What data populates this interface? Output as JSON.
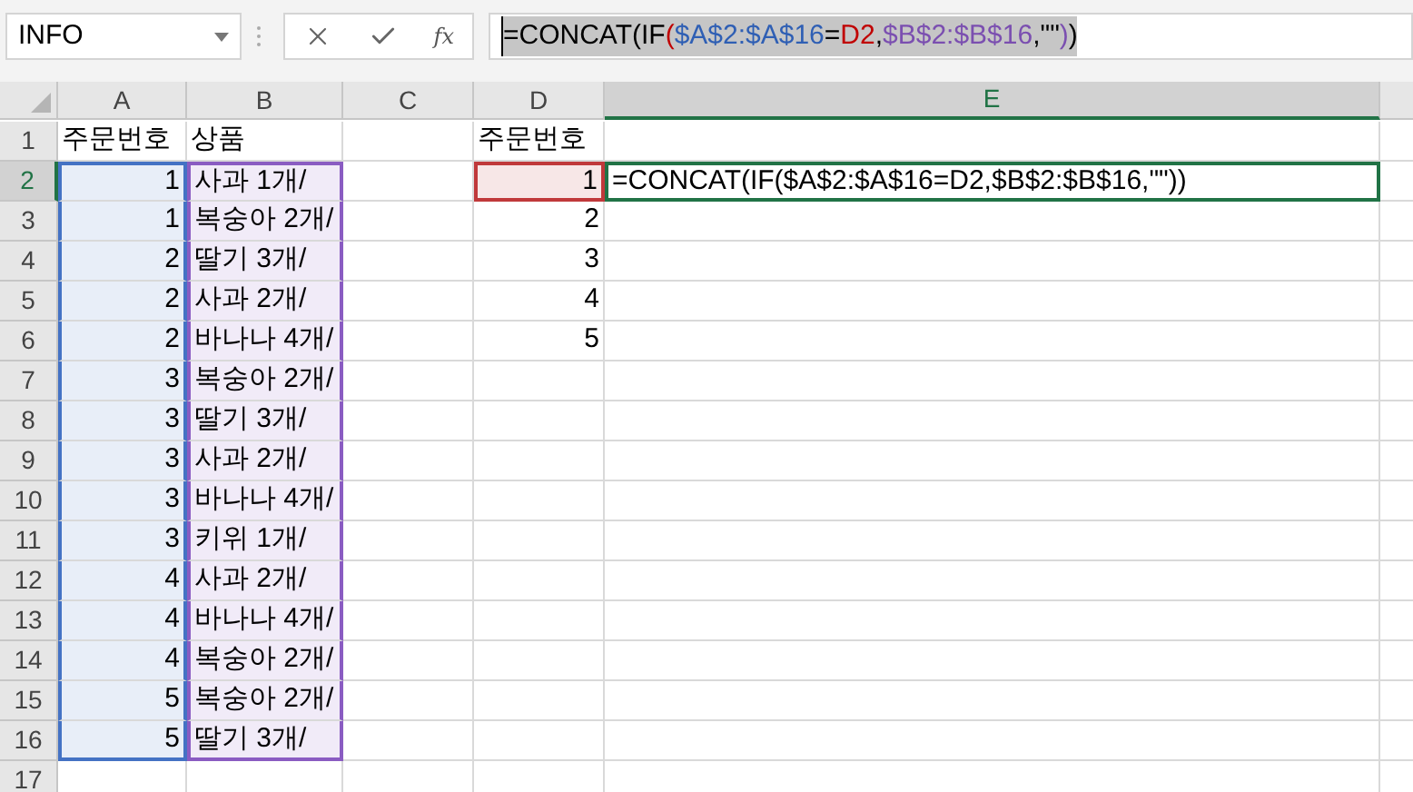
{
  "name_box": {
    "value": "INFO"
  },
  "formula_bar": {
    "function_button": "fx",
    "segments": [
      {
        "text": "=CONCAT(IF",
        "color": "#000000"
      },
      {
        "text": "(",
        "color": "#c00000"
      },
      {
        "text": "$A$2:$A$16",
        "color": "#2f5fb4"
      },
      {
        "text": "=",
        "color": "#000000"
      },
      {
        "text": "D2",
        "color": "#c00000"
      },
      {
        "text": ",",
        "color": "#000000"
      },
      {
        "text": "$B$2:$B$16",
        "color": "#7b4fb0"
      },
      {
        "text": ",\"\"",
        "color": "#000000"
      },
      {
        "text": ")",
        "color": "#7b4fb0"
      },
      {
        "text": ")",
        "color": "#000000"
      }
    ]
  },
  "columns": [
    {
      "label": "A",
      "selected": false
    },
    {
      "label": "B",
      "selected": false
    },
    {
      "label": "C",
      "selected": false
    },
    {
      "label": "D",
      "selected": false
    },
    {
      "label": "E",
      "selected": true
    }
  ],
  "rows": [
    {
      "number": "1",
      "selected": false,
      "cells": {
        "A": {
          "text": "주문번호",
          "kind": "text"
        },
        "B": {
          "text": "상품",
          "kind": "text"
        },
        "D": {
          "text": "주문번호",
          "kind": "text"
        }
      }
    },
    {
      "number": "2",
      "selected": true,
      "cells": {
        "A": {
          "text": "1",
          "kind": "number",
          "color": "#4472c4"
        },
        "B": {
          "text": "사과 1개/",
          "kind": "text",
          "color": "#8a5cc2"
        },
        "D": {
          "text": "1",
          "kind": "number",
          "color": "#c0393b"
        },
        "E": {
          "text": "=CONCAT(IF($A$2:$A$16=D2,$B$2:$B$16,\"\"))",
          "kind": "text",
          "active": true
        }
      }
    },
    {
      "number": "3",
      "selected": false,
      "cells": {
        "A": {
          "text": "1",
          "kind": "number",
          "color": "#4472c4"
        },
        "B": {
          "text": "복숭아 2개/",
          "kind": "text",
          "color": "#8a5cc2"
        },
        "D": {
          "text": "2",
          "kind": "number"
        }
      }
    },
    {
      "number": "4",
      "selected": false,
      "cells": {
        "A": {
          "text": "2",
          "kind": "number",
          "color": "#4472c4"
        },
        "B": {
          "text": "딸기 3개/",
          "kind": "text",
          "color": "#8a5cc2"
        },
        "D": {
          "text": "3",
          "kind": "number"
        }
      }
    },
    {
      "number": "5",
      "selected": false,
      "cells": {
        "A": {
          "text": "2",
          "kind": "number",
          "color": "#4472c4"
        },
        "B": {
          "text": "사과 2개/",
          "kind": "text",
          "color": "#8a5cc2"
        },
        "D": {
          "text": "4",
          "kind": "number"
        }
      }
    },
    {
      "number": "6",
      "selected": false,
      "cells": {
        "A": {
          "text": "2",
          "kind": "number",
          "color": "#4472c4"
        },
        "B": {
          "text": "바나나 4개/",
          "kind": "text",
          "color": "#8a5cc2"
        },
        "D": {
          "text": "5",
          "kind": "number"
        }
      }
    },
    {
      "number": "7",
      "selected": false,
      "cells": {
        "A": {
          "text": "3",
          "kind": "number",
          "color": "#4472c4"
        },
        "B": {
          "text": "복숭아 2개/",
          "kind": "text",
          "color": "#8a5cc2"
        }
      }
    },
    {
      "number": "8",
      "selected": false,
      "cells": {
        "A": {
          "text": "3",
          "kind": "number",
          "color": "#4472c4"
        },
        "B": {
          "text": "딸기 3개/",
          "kind": "text",
          "color": "#8a5cc2"
        }
      }
    },
    {
      "number": "9",
      "selected": false,
      "cells": {
        "A": {
          "text": "3",
          "kind": "number",
          "color": "#4472c4"
        },
        "B": {
          "text": "사과 2개/",
          "kind": "text",
          "color": "#8a5cc2"
        }
      }
    },
    {
      "number": "10",
      "selected": false,
      "cells": {
        "A": {
          "text": "3",
          "kind": "number",
          "color": "#4472c4"
        },
        "B": {
          "text": "바나나 4개/",
          "kind": "text",
          "color": "#8a5cc2"
        }
      }
    },
    {
      "number": "11",
      "selected": false,
      "cells": {
        "A": {
          "text": "3",
          "kind": "number",
          "color": "#4472c4"
        },
        "B": {
          "text": "키위 1개/",
          "kind": "text",
          "color": "#8a5cc2"
        }
      }
    },
    {
      "number": "12",
      "selected": false,
      "cells": {
        "A": {
          "text": "4",
          "kind": "number",
          "color": "#4472c4"
        },
        "B": {
          "text": "사과 2개/",
          "kind": "text",
          "color": "#8a5cc2"
        }
      }
    },
    {
      "number": "13",
      "selected": false,
      "cells": {
        "A": {
          "text": "4",
          "kind": "number",
          "color": "#4472c4"
        },
        "B": {
          "text": "바나나 4개/",
          "kind": "text",
          "color": "#8a5cc2"
        }
      }
    },
    {
      "number": "14",
      "selected": false,
      "cells": {
        "A": {
          "text": "4",
          "kind": "number",
          "color": "#4472c4"
        },
        "B": {
          "text": "복숭아 2개/",
          "kind": "text",
          "color": "#8a5cc2"
        }
      }
    },
    {
      "number": "15",
      "selected": false,
      "cells": {
        "A": {
          "text": "5",
          "kind": "number",
          "color": "#4472c4"
        },
        "B": {
          "text": "복숭아 2개/",
          "kind": "text",
          "color": "#8a5cc2"
        }
      }
    },
    {
      "number": "16",
      "selected": false,
      "cells": {
        "A": {
          "text": "5",
          "kind": "number",
          "color": "#4472c4"
        },
        "B": {
          "text": "딸기 3개/",
          "kind": "text",
          "color": "#8a5cc2"
        }
      }
    },
    {
      "number": "17",
      "selected": false,
      "cells": {}
    }
  ]
}
